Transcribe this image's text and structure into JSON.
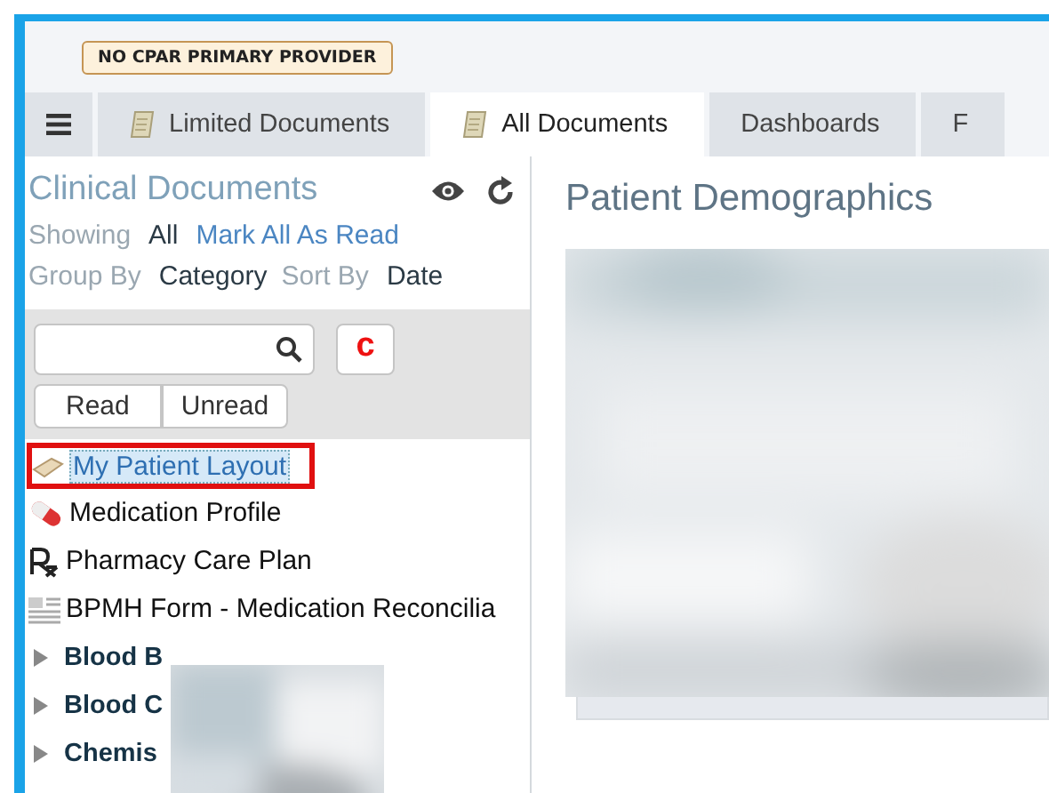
{
  "banner": {
    "badge": "NO CPAR PRIMARY PROVIDER"
  },
  "tabs": [
    {
      "label": "Limited Documents",
      "icon": true,
      "selected": false
    },
    {
      "label": "All Documents",
      "icon": true,
      "selected": true
    },
    {
      "label": "Dashboards",
      "icon": false,
      "selected": false
    },
    {
      "label": "F",
      "icon": false,
      "selected": false
    }
  ],
  "sidebar": {
    "title": "Clinical Documents",
    "showing_label": "Showing",
    "showing_value": "All",
    "mark_read": "Mark All As Read",
    "group_label": "Group By",
    "group_value": "Category",
    "sort_label": "Sort By",
    "sort_value": "Date",
    "clear_button": "c",
    "filters": [
      {
        "label": "Read"
      },
      {
        "label": "Unread"
      }
    ],
    "items": [
      {
        "label": "My Patient Layout",
        "kind": "layout",
        "selected": true
      },
      {
        "label": "Medication Profile",
        "kind": "pill",
        "selected": false
      },
      {
        "label": "Pharmacy Care Plan",
        "kind": "rx",
        "selected": false
      },
      {
        "label": "BPMH Form - Medication Reconcilia",
        "kind": "form",
        "selected": false
      },
      {
        "label": "Blood B",
        "kind": "folder",
        "selected": false
      },
      {
        "label": "Blood C",
        "kind": "folder",
        "selected": false
      },
      {
        "label": "Chemis",
        "kind": "folder",
        "selected": false
      }
    ]
  },
  "main": {
    "title": "Patient Demographics"
  }
}
